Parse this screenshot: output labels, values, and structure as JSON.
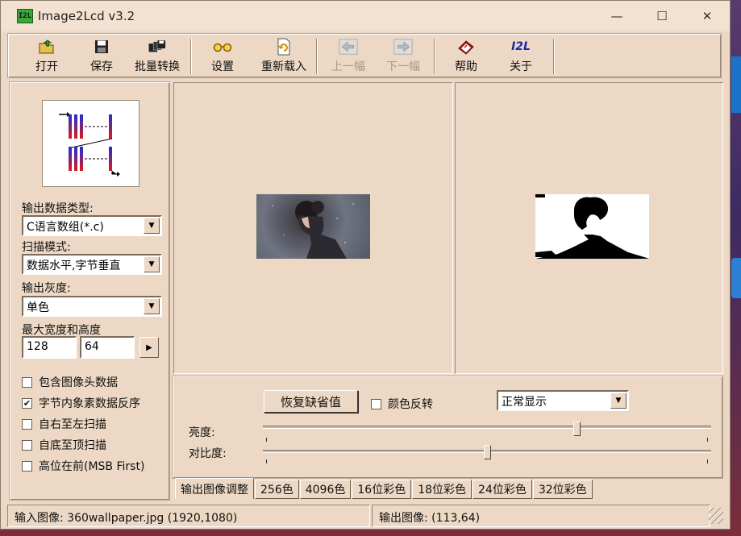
{
  "window": {
    "title": "Image2Lcd v3.2",
    "icon_label": "I2L",
    "controls": {
      "minimize": "—",
      "maximize": "☐",
      "close": "✕"
    }
  },
  "toolbar": {
    "open": "打开",
    "save": "保存",
    "batch": "批量转换",
    "settings": "设置",
    "reload": "重新载入",
    "prev": "上一幅",
    "next": "下一幅",
    "help": "帮助",
    "about": "关于",
    "about_icon_text": "I2L"
  },
  "left_panel": {
    "output_type_label": "输出数据类型:",
    "output_type_value": "C语言数组(*.c)",
    "scan_mode_label": "扫描模式:",
    "scan_mode_value": "数据水平,字节垂直",
    "gray_label": "输出灰度:",
    "gray_value": "单色",
    "size_label": "最大宽度和高度",
    "max_width": "128",
    "max_height": "64",
    "options": [
      {
        "label": "包含图像头数据",
        "checked": false
      },
      {
        "label": "字节内象素数据反序",
        "checked": true
      },
      {
        "label": "自右至左扫描",
        "checked": false
      },
      {
        "label": "自底至顶扫描",
        "checked": false
      },
      {
        "label": "高位在前(MSB First)",
        "checked": false
      }
    ]
  },
  "adjust": {
    "reset_label": "恢复缺省值",
    "invert_label": "颜色反转",
    "invert_checked": false,
    "display_mode": "正常显示",
    "brightness_label": "亮度:",
    "contrast_label": "对比度:",
    "brightness_level": 0.7,
    "contrast_level": 0.5
  },
  "tabs": [
    "输出图像调整",
    "256色",
    "4096色",
    "16位彩色",
    "18位彩色",
    "24位彩色",
    "32位彩色"
  ],
  "status": {
    "input": "输入图像: 360wallpaper.jpg (1920,1080)",
    "output": "输出图像: (113,64)"
  },
  "colors": {
    "window_bg": "#ecd8c4",
    "titlebar_bg": "#f3e2d1",
    "icon_green": "#38a83a"
  }
}
